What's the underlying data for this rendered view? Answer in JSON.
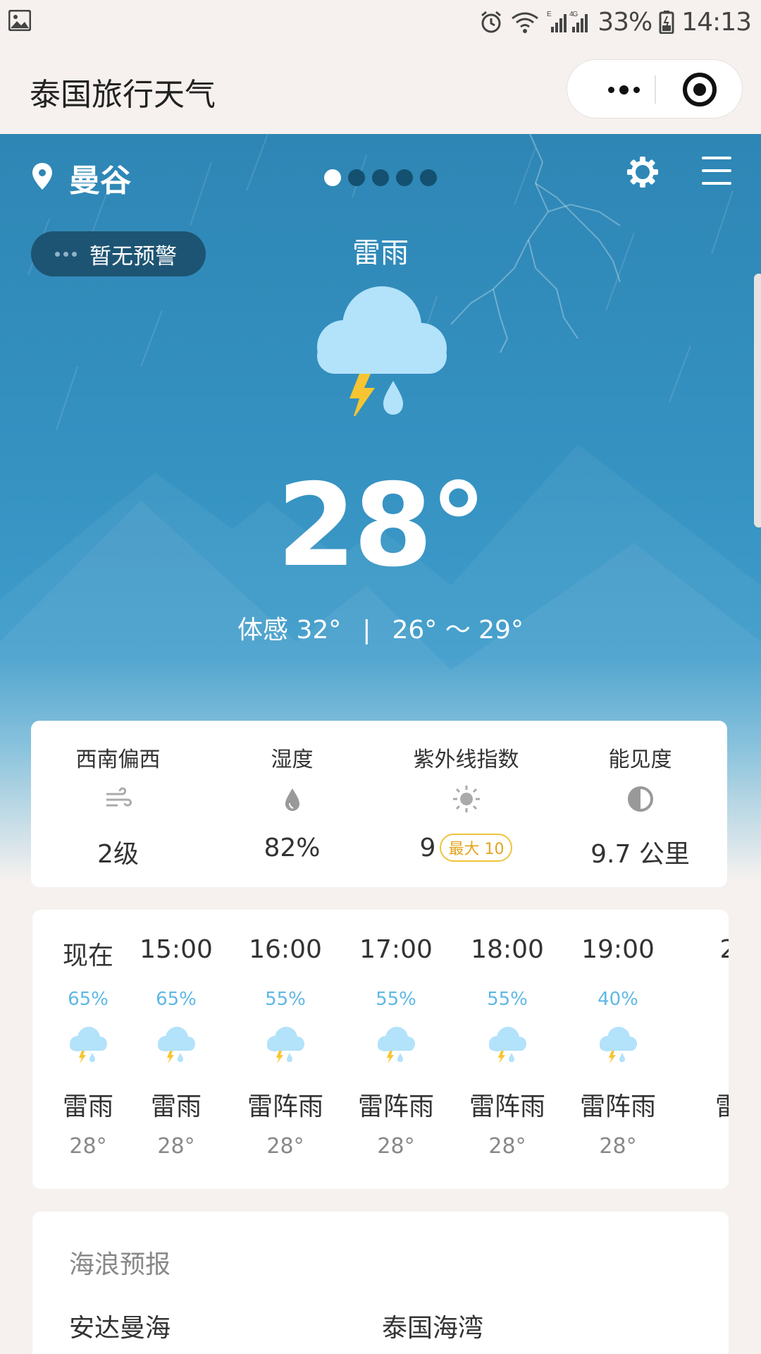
{
  "status_bar": {
    "battery": "33%",
    "time": "14:13",
    "icons": [
      "gallery-icon",
      "alarm-icon",
      "wifi-icon",
      "signal-icon",
      "battery-icon"
    ]
  },
  "header": {
    "title": "泰国旅行天气",
    "icons": [
      "more-icon",
      "close-icon"
    ]
  },
  "hero": {
    "city": "曼谷",
    "page_count": 5,
    "active_page": 1,
    "warning": "暂无预警",
    "condition": "雷雨",
    "temperature": "28°",
    "feels_like": "体感 32°",
    "separator": "|",
    "range": "26° ～ 29°",
    "icons": [
      "location-pin-icon",
      "settings-gear-icon",
      "menu-icon",
      "thunder-rain-icon"
    ]
  },
  "metrics": [
    {
      "label": "西南偏西",
      "icon": "wind-icon",
      "value": "2级"
    },
    {
      "label": "湿度",
      "icon": "humidity-drop-icon",
      "value": "82%"
    },
    {
      "label": "紫外线指数",
      "icon": "sun-icon",
      "value": "9",
      "badge": "最大 10"
    },
    {
      "label": "能见度",
      "icon": "visibility-icon",
      "value": "9.7 公里"
    }
  ],
  "hourly": [
    {
      "time": "现在",
      "prob": "65%",
      "cond": "雷雨",
      "temp": "28°"
    },
    {
      "time": "15:00",
      "prob": "65%",
      "cond": "雷雨",
      "temp": "28°"
    },
    {
      "time": "16:00",
      "prob": "55%",
      "cond": "雷阵雨",
      "temp": "28°"
    },
    {
      "time": "17:00",
      "prob": "55%",
      "cond": "雷阵雨",
      "temp": "28°"
    },
    {
      "time": "18:00",
      "prob": "55%",
      "cond": "雷阵雨",
      "temp": "28°"
    },
    {
      "time": "19:00",
      "prob": "40%",
      "cond": "雷阵雨",
      "temp": "28°"
    },
    {
      "time": "2",
      "prob": "",
      "cond": "雷",
      "temp": ""
    }
  ],
  "waves": {
    "title": "海浪预报",
    "seas": [
      "安达曼海",
      "泰国海湾"
    ]
  },
  "colors": {
    "sky": "#2e86b5",
    "probability": "#5fb8e4",
    "uv_badge": "#e3a41f",
    "active_dot": "#ffffff",
    "inactive_dot": "#14506f"
  }
}
